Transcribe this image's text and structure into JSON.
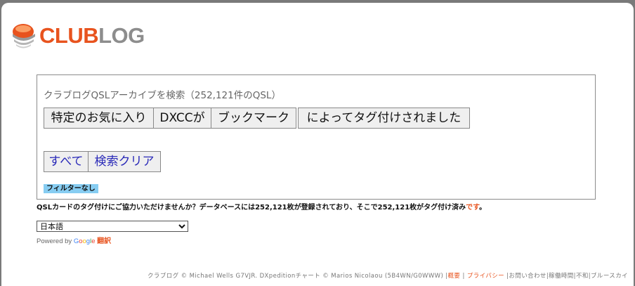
{
  "brand": {
    "part1": "CLUB",
    "part2": "LOG",
    "accent": "#e8531e"
  },
  "search": {
    "title": "クラブログQSLアーカイブを検索（252,121件のQSL）",
    "buttons": [
      "特定のお気に入り",
      "DXCCが",
      "ブックマーク",
      "によってタグ付けされました"
    ],
    "all_label": "すべて",
    "clear_label": "検索クリア",
    "filter_badge": "フィルターなし"
  },
  "help_text": {
    "main": "QSLカードのタグ付けにご協力いただけませんか？データベースには252,121枚が登録されており、そこで252,121枚がタグ付け済み",
    "accent": "です",
    "end": "。"
  },
  "language": {
    "selected": "日本語"
  },
  "powered_by": {
    "prefix": "Powered by ",
    "google": [
      "G",
      "o",
      "o",
      "g",
      "l",
      "e"
    ],
    "translate": "翻訳"
  },
  "footer": {
    "credits": "クラブログ © Michael Wells G7VJR. DXpeditionチャート © Marios Nicolaou (5B4WN/G0WWW) |",
    "links": [
      "概要",
      "プライバシー"
    ],
    "separator1": " | ",
    "separator2": " |",
    "rest": "お問い合わせ|稼働時間|不和|ブルースカイ"
  }
}
